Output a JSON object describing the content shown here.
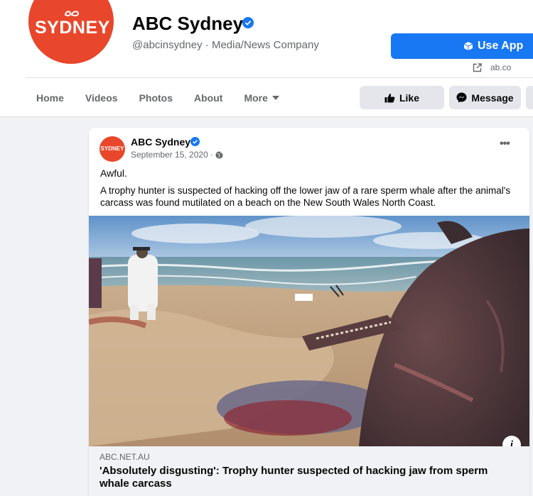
{
  "page": {
    "logo_text": "SYDNEY",
    "name": "ABC Sydney",
    "handle": "@abcinsydney · Media/News Company",
    "brand_color": "#e8472b",
    "accent_color": "#1877f2"
  },
  "actions": {
    "use_app": "Use App",
    "link": "ab.co",
    "like": "Like",
    "message": "Message"
  },
  "nav": {
    "items": [
      "Home",
      "Videos",
      "Photos",
      "About",
      "More"
    ]
  },
  "post": {
    "avatar_text": "SYDNEY",
    "author": "ABC Sydney",
    "date": "September 15, 2020",
    "date_sep": "·",
    "menu": "•••",
    "text_short": "Awful.",
    "text_body": "A trophy hunter is suspected of hacking off the lower jaw of a rare sperm whale after the animal's carcass was found mutilated on a beach on the New South Wales North Coast.",
    "info": "i",
    "link_domain": "ABC.NET.AU",
    "link_title": "'Absolutely disgusting': Trophy hunter suspected of hacking jaw from sperm whale carcass"
  }
}
